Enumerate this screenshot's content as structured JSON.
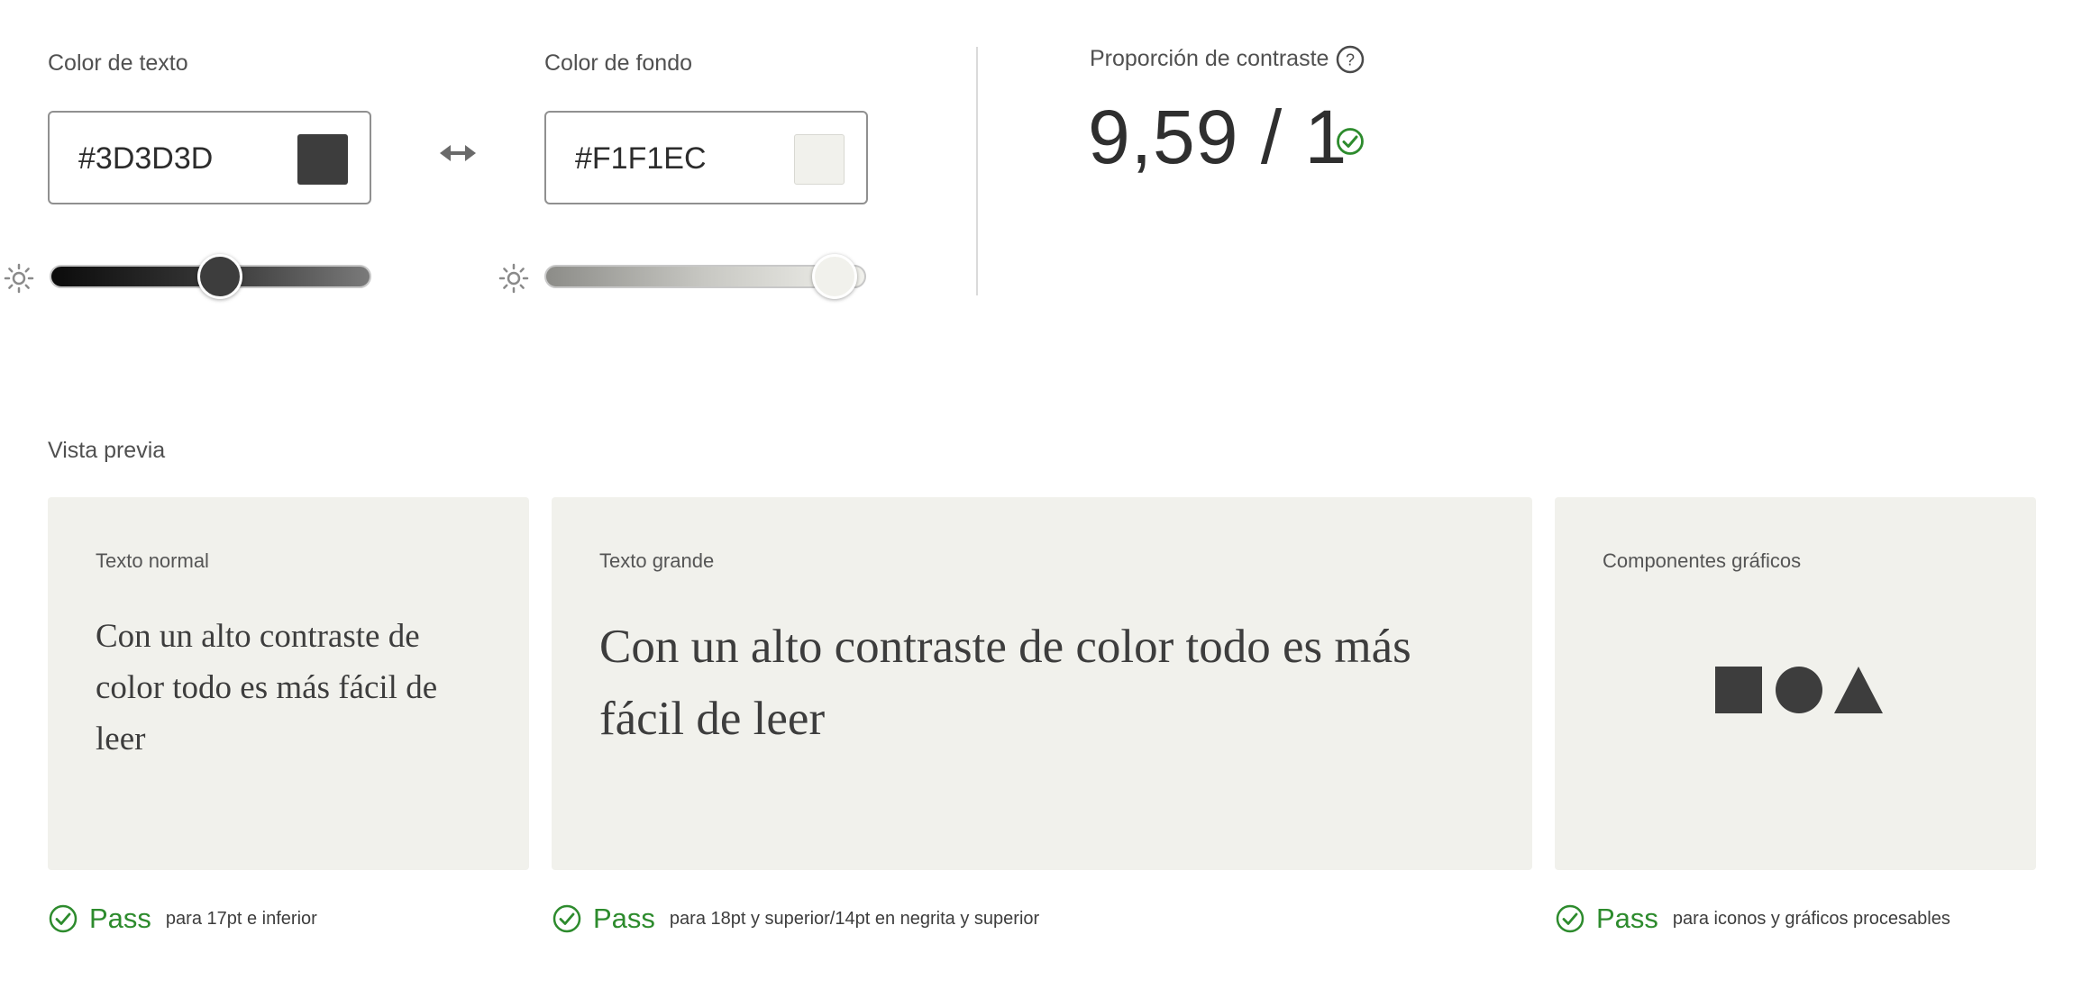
{
  "text_color": {
    "label": "Color de texto",
    "value": "#3D3D3D",
    "swatch": "#3D3D3D",
    "brightness": 0.53,
    "brightness_icon": "brightness-icon"
  },
  "swap_icon": "swap-arrows-icon",
  "bg_color": {
    "label": "Color de fondo",
    "value": "#F1F1EC",
    "swatch": "#F1F1EC",
    "brightness": 1.0,
    "brightness_icon": "brightness-icon"
  },
  "contrast": {
    "label": "Proporción de contraste",
    "help_icon": "help-icon",
    "ratio": "9,59 / 1",
    "status_icon": "check-circle-icon",
    "status_color": "#2d8b2d"
  },
  "preview": {
    "label": "Vista previa",
    "cards": [
      {
        "title": "Texto normal",
        "sample": "Con un alto contraste de color todo es más fácil de leer"
      },
      {
        "title": "Texto grande",
        "sample": "Con un alto contraste de color todo es más fácil de leer"
      },
      {
        "title": "Componentes gráficos",
        "shapes": [
          "square",
          "circle",
          "triangle"
        ]
      }
    ],
    "card_bg": "#F1F1EC",
    "results": [
      {
        "status": "Pass",
        "description": "para 17pt e inferior"
      },
      {
        "status": "Pass",
        "description": "para 18pt y superior/14pt en negrita y superior"
      },
      {
        "status": "Pass",
        "description": "para iconos y gráficos procesables"
      }
    ]
  }
}
